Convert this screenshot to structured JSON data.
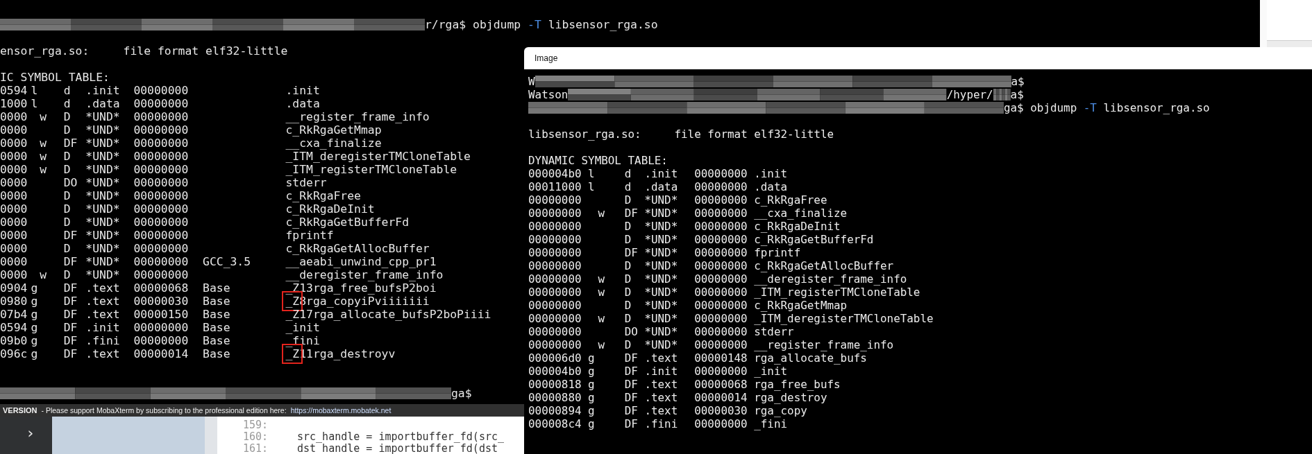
{
  "background_terminal": {
    "command_line": [
      {
        "kind": "mosaic"
      },
      {
        "kind": "text",
        "text": "r/rga$ objdump "
      },
      {
        "kind": "option",
        "text": "-T"
      },
      {
        "kind": "text",
        "text": " libsensor_rga.so"
      }
    ],
    "file_line": "ensor_rga.so:     file format elf32-little",
    "table_heading": "IC SYMBOL TABLE:",
    "symbols": [
      {
        "cells": [
          "0594",
          "l",
          "",
          "d",
          ".init",
          "00000000",
          "",
          ".init"
        ],
        "highlighted": false
      },
      {
        "cells": [
          "1000",
          "l",
          "",
          "d",
          ".data",
          "00000000",
          "",
          ".data"
        ],
        "highlighted": false
      },
      {
        "cells": [
          "0000",
          "",
          "w",
          "D",
          "*UND*",
          "00000000",
          "",
          "__register_frame_info"
        ],
        "highlighted": false
      },
      {
        "cells": [
          "0000",
          "",
          "",
          "D",
          "*UND*",
          "00000000",
          "",
          "c_RkRgaGetMmap"
        ],
        "highlighted": false
      },
      {
        "cells": [
          "0000",
          "",
          "w",
          "DF",
          "*UND*",
          "00000000",
          "",
          "__cxa_finalize"
        ],
        "highlighted": false
      },
      {
        "cells": [
          "0000",
          "",
          "w",
          "D",
          "*UND*",
          "00000000",
          "",
          "_ITM_deregisterTMCloneTable"
        ],
        "highlighted": false
      },
      {
        "cells": [
          "0000",
          "",
          "w",
          "D",
          "*UND*",
          "00000000",
          "",
          "_ITM_registerTMCloneTable"
        ],
        "highlighted": false
      },
      {
        "cells": [
          "0000",
          "",
          "",
          "DO",
          "*UND*",
          "00000000",
          "",
          "stderr"
        ],
        "highlighted": false
      },
      {
        "cells": [
          "0000",
          "",
          "",
          "D",
          "*UND*",
          "00000000",
          "",
          "c_RkRgaFree"
        ],
        "highlighted": false
      },
      {
        "cells": [
          "0000",
          "",
          "",
          "D",
          "*UND*",
          "00000000",
          "",
          "c_RkRgaDeInit"
        ],
        "highlighted": false
      },
      {
        "cells": [
          "0000",
          "",
          "",
          "D",
          "*UND*",
          "00000000",
          "",
          "c_RkRgaGetBufferFd"
        ],
        "highlighted": false
      },
      {
        "cells": [
          "0000",
          "",
          "",
          "DF",
          "*UND*",
          "00000000",
          "",
          "fprintf"
        ],
        "highlighted": false
      },
      {
        "cells": [
          "0000",
          "",
          "",
          "D",
          "*UND*",
          "00000000",
          "",
          "c_RkRgaGetAllocBuffer"
        ],
        "highlighted": false
      },
      {
        "cells": [
          "0000",
          "",
          "",
          "DF",
          "*UND*",
          "00000000",
          "GCC_3.5",
          "__aeabi_unwind_cpp_pr1"
        ],
        "highlighted": false
      },
      {
        "cells": [
          "0000",
          "",
          "w",
          "D",
          "*UND*",
          "00000000",
          "",
          "__deregister_frame_info"
        ],
        "highlighted": false
      },
      {
        "cells": [
          "0904",
          "g",
          "",
          "DF",
          ".text",
          "00000068",
          "Base",
          "_Z13rga_free_bufsP2boi"
        ],
        "highlighted": false
      },
      {
        "cells": [
          "0980",
          "g",
          "",
          "DF",
          ".text",
          "00000030",
          "Base",
          "_Z8rga_copyiPviiiiiii"
        ],
        "highlighted": true
      },
      {
        "cells": [
          "07b4",
          "g",
          "",
          "DF",
          ".text",
          "00000150",
          "Base",
          "_Z17rga_allocate_bufsP2boPiiii"
        ],
        "highlighted": false
      },
      {
        "cells": [
          "0594",
          "g",
          "",
          "DF",
          ".init",
          "00000000",
          "Base",
          "_init"
        ],
        "highlighted": false
      },
      {
        "cells": [
          "09b0",
          "g",
          "",
          "DF",
          ".fini",
          "00000000",
          "Base",
          "_fini"
        ],
        "highlighted": false
      },
      {
        "cells": [
          "096c",
          "g",
          "",
          "DF",
          ".text",
          "00000014",
          "Base",
          "_Z11rga_destroyv"
        ],
        "highlighted": true
      }
    ],
    "prompt_line": [
      {
        "kind": "mosaic"
      },
      {
        "kind": "text",
        "text": "ga$"
      }
    ]
  },
  "status_bar": {
    "badge": "VERSION",
    "message": "- Please support MobaXterm by subscribing to the professional edition here:",
    "link": "https://mobaxterm.mobatek.net"
  },
  "editor": {
    "sidebar_toggle": "›",
    "lines": [
      {
        "number": "159:"
      },
      {
        "number": "160:",
        "code": "src_handle = importbuffer_fd(src_"
      },
      {
        "number": "161:",
        "code": "dst_handle = importbuffer_fd(dst_"
      }
    ]
  },
  "image_window": {
    "title": "Image",
    "prompt_lines": [
      [
        {
          "kind": "text",
          "text": "W"
        },
        {
          "kind": "mosaic"
        },
        {
          "kind": "text",
          "text": "a$"
        }
      ],
      [
        {
          "kind": "text",
          "text": "Watson"
        },
        {
          "kind": "mosaic"
        },
        {
          "kind": "text",
          "text": "/hyper/"
        },
        {
          "kind": "mosaic"
        },
        {
          "kind": "text",
          "text": "a$"
        }
      ],
      [
        {
          "kind": "mosaic"
        },
        {
          "kind": "text",
          "text": "ga$ objdump "
        },
        {
          "kind": "option",
          "text": "-T"
        },
        {
          "kind": "text",
          "text": " libsensor_rga.so"
        }
      ]
    ],
    "file_line": "libsensor_rga.so:     file format elf32-little",
    "table_heading": "DYNAMIC SYMBOL TABLE:",
    "symbols": [
      {
        "cells": [
          "000004b0",
          "l",
          "",
          "d",
          ".init",
          "00000000",
          ".init"
        ]
      },
      {
        "cells": [
          "00011000",
          "l",
          "",
          "d",
          ".data",
          "00000000",
          ".data"
        ]
      },
      {
        "cells": [
          "00000000",
          "",
          "",
          "D",
          "*UND*",
          "00000000",
          "c_RkRgaFree"
        ]
      },
      {
        "cells": [
          "00000000",
          "",
          "w",
          "DF",
          "*UND*",
          "00000000",
          "__cxa_finalize"
        ]
      },
      {
        "cells": [
          "00000000",
          "",
          "",
          "D",
          "*UND*",
          "00000000",
          "c_RkRgaDeInit"
        ]
      },
      {
        "cells": [
          "00000000",
          "",
          "",
          "D",
          "*UND*",
          "00000000",
          "c_RkRgaGetBufferFd"
        ]
      },
      {
        "cells": [
          "00000000",
          "",
          "",
          "DF",
          "*UND*",
          "00000000",
          "fprintf"
        ]
      },
      {
        "cells": [
          "00000000",
          "",
          "",
          "D",
          "*UND*",
          "00000000",
          "c_RkRgaGetAllocBuffer"
        ]
      },
      {
        "cells": [
          "00000000",
          "",
          "w",
          "D",
          "*UND*",
          "00000000",
          "__deregister_frame_info"
        ]
      },
      {
        "cells": [
          "00000000",
          "",
          "w",
          "D",
          "*UND*",
          "00000000",
          "_ITM_registerTMCloneTable"
        ]
      },
      {
        "cells": [
          "00000000",
          "",
          "",
          "D",
          "*UND*",
          "00000000",
          "c_RkRgaGetMmap"
        ]
      },
      {
        "cells": [
          "00000000",
          "",
          "w",
          "D",
          "*UND*",
          "00000000",
          "_ITM_deregisterTMCloneTable"
        ]
      },
      {
        "cells": [
          "00000000",
          "",
          "",
          "DO",
          "*UND*",
          "00000000",
          "stderr"
        ]
      },
      {
        "cells": [
          "00000000",
          "",
          "w",
          "D",
          "*UND*",
          "00000000",
          "__register_frame_info"
        ]
      },
      {
        "cells": [
          "000006d0",
          "g",
          "",
          "DF",
          ".text",
          "00000148",
          "rga_allocate_bufs"
        ]
      },
      {
        "cells": [
          "000004b0",
          "g",
          "",
          "DF",
          ".init",
          "00000000",
          "_init"
        ]
      },
      {
        "cells": [
          "00000818",
          "g",
          "",
          "DF",
          ".text",
          "00000068",
          "rga_free_bufs"
        ]
      },
      {
        "cells": [
          "00000880",
          "g",
          "",
          "DF",
          ".text",
          "00000014",
          "rga_destroy"
        ]
      },
      {
        "cells": [
          "00000894",
          "g",
          "",
          "DF",
          ".text",
          "00000030",
          "rga_copy"
        ]
      },
      {
        "cells": [
          "000008c4",
          "g",
          "",
          "DF",
          ".fini",
          "00000000",
          "_fini"
        ]
      }
    ]
  }
}
